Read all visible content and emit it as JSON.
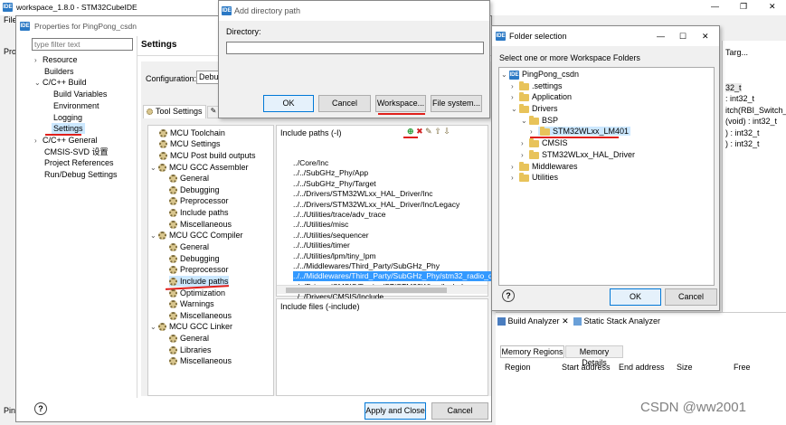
{
  "main_window": {
    "title": "workspace_1.8.0 - STM32CubeIDE",
    "menu_items": [
      "File",
      "E"
    ],
    "minimize": "—",
    "restore": "❐",
    "close": "✕"
  },
  "properties": {
    "title": "Properties for PingPong_csdn",
    "filter_placeholder": "type filter text",
    "nav": {
      "resource": "Resource",
      "builders": "Builders",
      "cc_build": "C/C++ Build",
      "build_variables": "Build Variables",
      "environment": "Environment",
      "logging": "Logging",
      "settings": "Settings",
      "cc_general": "C/C++ General",
      "cmsis_svd": "CMSIS-SVD 设置",
      "project_references": "Project References",
      "run_debug": "Run/Debug Settings"
    },
    "settings_heading": "Settings",
    "configuration_label": "Configuration:",
    "configuration_value": "Debug",
    "tool_settings_tab": "Tool Settings",
    "tools_tree": {
      "mcu_toolchain": "MCU Toolchain",
      "mcu_settings": "MCU Settings",
      "mcu_post_build": "MCU Post build outputs",
      "mcu_gcc_assembler": "MCU GCC Assembler",
      "asm_general": "General",
      "asm_debugging": "Debugging",
      "asm_preprocessor": "Preprocessor",
      "asm_include_paths": "Include paths",
      "asm_misc": "Miscellaneous",
      "mcu_gcc_compiler": "MCU GCC Compiler",
      "cc_general": "General",
      "cc_debugging": "Debugging",
      "cc_preprocessor": "Preprocessor",
      "cc_include_paths": "Include paths",
      "cc_optimization": "Optimization",
      "cc_warnings": "Warnings",
      "cc_misc": "Miscellaneous",
      "mcu_gcc_linker": "MCU GCC Linker",
      "ld_general": "General",
      "ld_libraries": "Libraries",
      "ld_misc": "Miscellaneous"
    },
    "include_paths_title": "Include paths (-I)",
    "include_paths": [
      "../Core/Inc",
      "../../SubGHz_Phy/App",
      "../../SubGHz_Phy/Target",
      "../../Drivers/STM32WLxx_HAL_Driver/Inc",
      "../../Drivers/STM32WLxx_HAL_Driver/Inc/Legacy",
      "../../Utilities/trace/adv_trace",
      "../../Utilities/misc",
      "../../Utilities/sequencer",
      "../../Utilities/timer",
      "../../Utilities/lpm/tiny_lpm",
      "../../Middlewares/Third_Party/SubGHz_Phy",
      "../../Middlewares/Third_Party/SubGHz_Phy/stm32_radio_dri",
      "../../Drivers/CMSIS/Device/ST/STM32WLxx/Include",
      "../../Drivers/CMSIS/Include"
    ],
    "include_files_title": "Include files (-include)",
    "apply_close": "Apply and Close",
    "cancel": "Cancel",
    "help": "?"
  },
  "add_dir": {
    "title": "Add directory path",
    "directory_label": "Directory:",
    "directory_value": "",
    "ok": "OK",
    "cancel": "Cancel",
    "workspace": "Workspace...",
    "file_system": "File system..."
  },
  "folder_sel": {
    "title": "Folder selection",
    "instruction": "Select one or more Workspace Folders",
    "tree": {
      "project": "PingPong_csdn",
      "settings": ".settings",
      "application": "Application",
      "drivers": "Drivers",
      "bsp": "BSP",
      "stm32wlxx_lm401": "STM32WLxx_LM401",
      "cmsis": "CMSIS",
      "hal_driver": "STM32WLxx_HAL_Driver",
      "middlewares": "Middlewares",
      "utilities": "Utilities"
    },
    "ok": "OK",
    "cancel": "Cancel",
    "help": "?"
  },
  "background": {
    "right_header": "Targ...",
    "right_lines": [
      "32_t",
      ": int32_t",
      "itch(RBI_Switch_Ty",
      "(void) : int32_t",
      ") : int32_t",
      ") : int32_t"
    ],
    "build_analyzer": "Build Analyzer",
    "static_stack": "Static Stack Analyzer",
    "memory_regions": "Memory Regions",
    "memory_details": "Memory Details",
    "columns": [
      "Region",
      "Start address",
      "End address",
      "Size",
      "Free"
    ],
    "left_labels": [
      "Pro",
      "Ping"
    ],
    "watermark": "CSDN @ww2001"
  },
  "colors": {
    "selection": "#cce8ff",
    "highlight_row": "#3399ff",
    "annotation_red": "#e0201c",
    "ide_blue": "#2b79c5"
  }
}
